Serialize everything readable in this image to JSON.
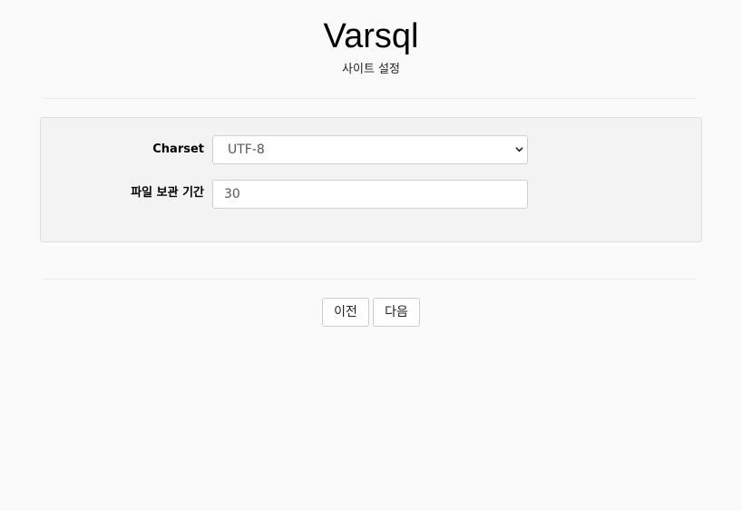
{
  "header": {
    "title": "Varsql",
    "subtitle": "사이트 설정"
  },
  "form": {
    "charset": {
      "label": "Charset",
      "selected_value": "UTF-8",
      "icon": "chevron-down-icon"
    },
    "retention": {
      "label": "파일 보관 기간",
      "value": "30"
    }
  },
  "buttons": {
    "prev_label": "이전",
    "next_label": "다음"
  }
}
